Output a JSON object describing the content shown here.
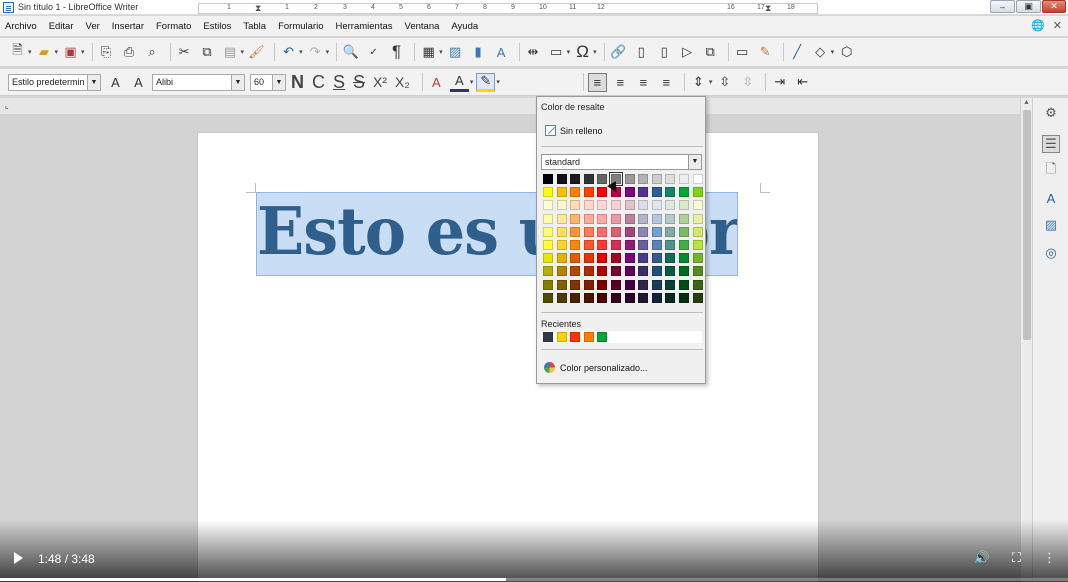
{
  "window": {
    "title": "Sin título 1 - LibreOffice Writer",
    "buttons": [
      "–",
      "▣",
      "✕"
    ]
  },
  "menu": [
    "Archivo",
    "Editar",
    "Ver",
    "Insertar",
    "Formato",
    "Estilos",
    "Tabla",
    "Formulario",
    "Herramientas",
    "Ventana",
    "Ayuda"
  ],
  "formatting": {
    "paragraph_style": "Estilo predetermin",
    "font_name": "Alibi",
    "font_size": "60",
    "bold": "N",
    "italic": "C",
    "underline": "S",
    "strikethrough": "S",
    "superscript": "X²",
    "subscript": "X₂"
  },
  "ruler": {
    "numbers": [
      "1",
      "1",
      "2",
      "3",
      "4",
      "5",
      "6",
      "7",
      "8",
      "9",
      "10",
      "11",
      "12",
      "16",
      "17",
      "18"
    ]
  },
  "document": {
    "text": "Esto  es  una  prueba"
  },
  "highlight_popup": {
    "title": "Color de resalte",
    "no_fill": "Sin relleno",
    "palette": "standard",
    "recent_label": "Recientes",
    "custom": "Color personalizado...",
    "colors": [
      [
        "#000000",
        "#111111",
        "#1c1c1c",
        "#333333",
        "#666666",
        "#808080",
        "#999999",
        "#b2b2b2",
        "#cccccc",
        "#dddddd",
        "#eeeeee",
        "#ffffff"
      ],
      [
        "#ffff00",
        "#ffbf00",
        "#ff8000",
        "#ff4000",
        "#ff0000",
        "#bf0041",
        "#800080",
        "#55308d",
        "#2a6099",
        "#158466",
        "#00a933",
        "#81d41a"
      ],
      [
        "#ffffd7",
        "#fff5ce",
        "#ffdbb6",
        "#ffd8ce",
        "#ffd7d7",
        "#f7d1d5",
        "#e0c2cd",
        "#dedce6",
        "#dee6ef",
        "#dee7e5",
        "#dde8cb",
        "#f6f9d4"
      ],
      [
        "#ffffa6",
        "#ffe994",
        "#ffb66c",
        "#ffaa95",
        "#ffa6a6",
        "#ec9ba4",
        "#bf819e",
        "#b7b3ca",
        "#b4c7dc",
        "#b3cac7",
        "#afd095",
        "#e8f2a1"
      ],
      [
        "#ffff6d",
        "#ffde59",
        "#ff972f",
        "#ff7b59",
        "#ff6d6d",
        "#e16173",
        "#a1467e",
        "#8e86ae",
        "#729fcf",
        "#81aca6",
        "#77bc65",
        "#d4ea6b"
      ],
      [
        "#ffff38",
        "#ffd428",
        "#ff860d",
        "#ff5429",
        "#ff3838",
        "#d62e4e",
        "#8d1d75",
        "#6b5e9b",
        "#5983b0",
        "#50938a",
        "#3faf46",
        "#bbe33d"
      ],
      [
        "#e6e600",
        "#e6b400",
        "#e65c00",
        "#e63600",
        "#e60000",
        "#a50021",
        "#7b0080",
        "#483d8b",
        "#335b8b",
        "#0d6b58",
        "#008c2e",
        "#78b327"
      ],
      [
        "#b2b200",
        "#b28500",
        "#b24800",
        "#b22b00",
        "#b20000",
        "#78002e",
        "#5e005e",
        "#3b2f66",
        "#1f4e79",
        "#0b5843",
        "#006b1f",
        "#5a8a1c"
      ],
      [
        "#808000",
        "#806000",
        "#803300",
        "#801e00",
        "#800000",
        "#560020",
        "#420042",
        "#2e2647",
        "#1a3a5c",
        "#084033",
        "#004d15",
        "#3f6314"
      ],
      [
        "#4d4d00",
        "#4d3b00",
        "#4d1f00",
        "#4d1200",
        "#4d0000",
        "#35001a",
        "#290029",
        "#1c1830",
        "#10233a",
        "#052a21",
        "#00310e",
        "#283e0c"
      ]
    ],
    "recent_colors": [
      "#2f3b4d",
      "#ffd200",
      "#ff3300",
      "#ff8000",
      "#00a933"
    ]
  },
  "video": {
    "time": "1:48 / 3:48",
    "progress": 0.474
  }
}
